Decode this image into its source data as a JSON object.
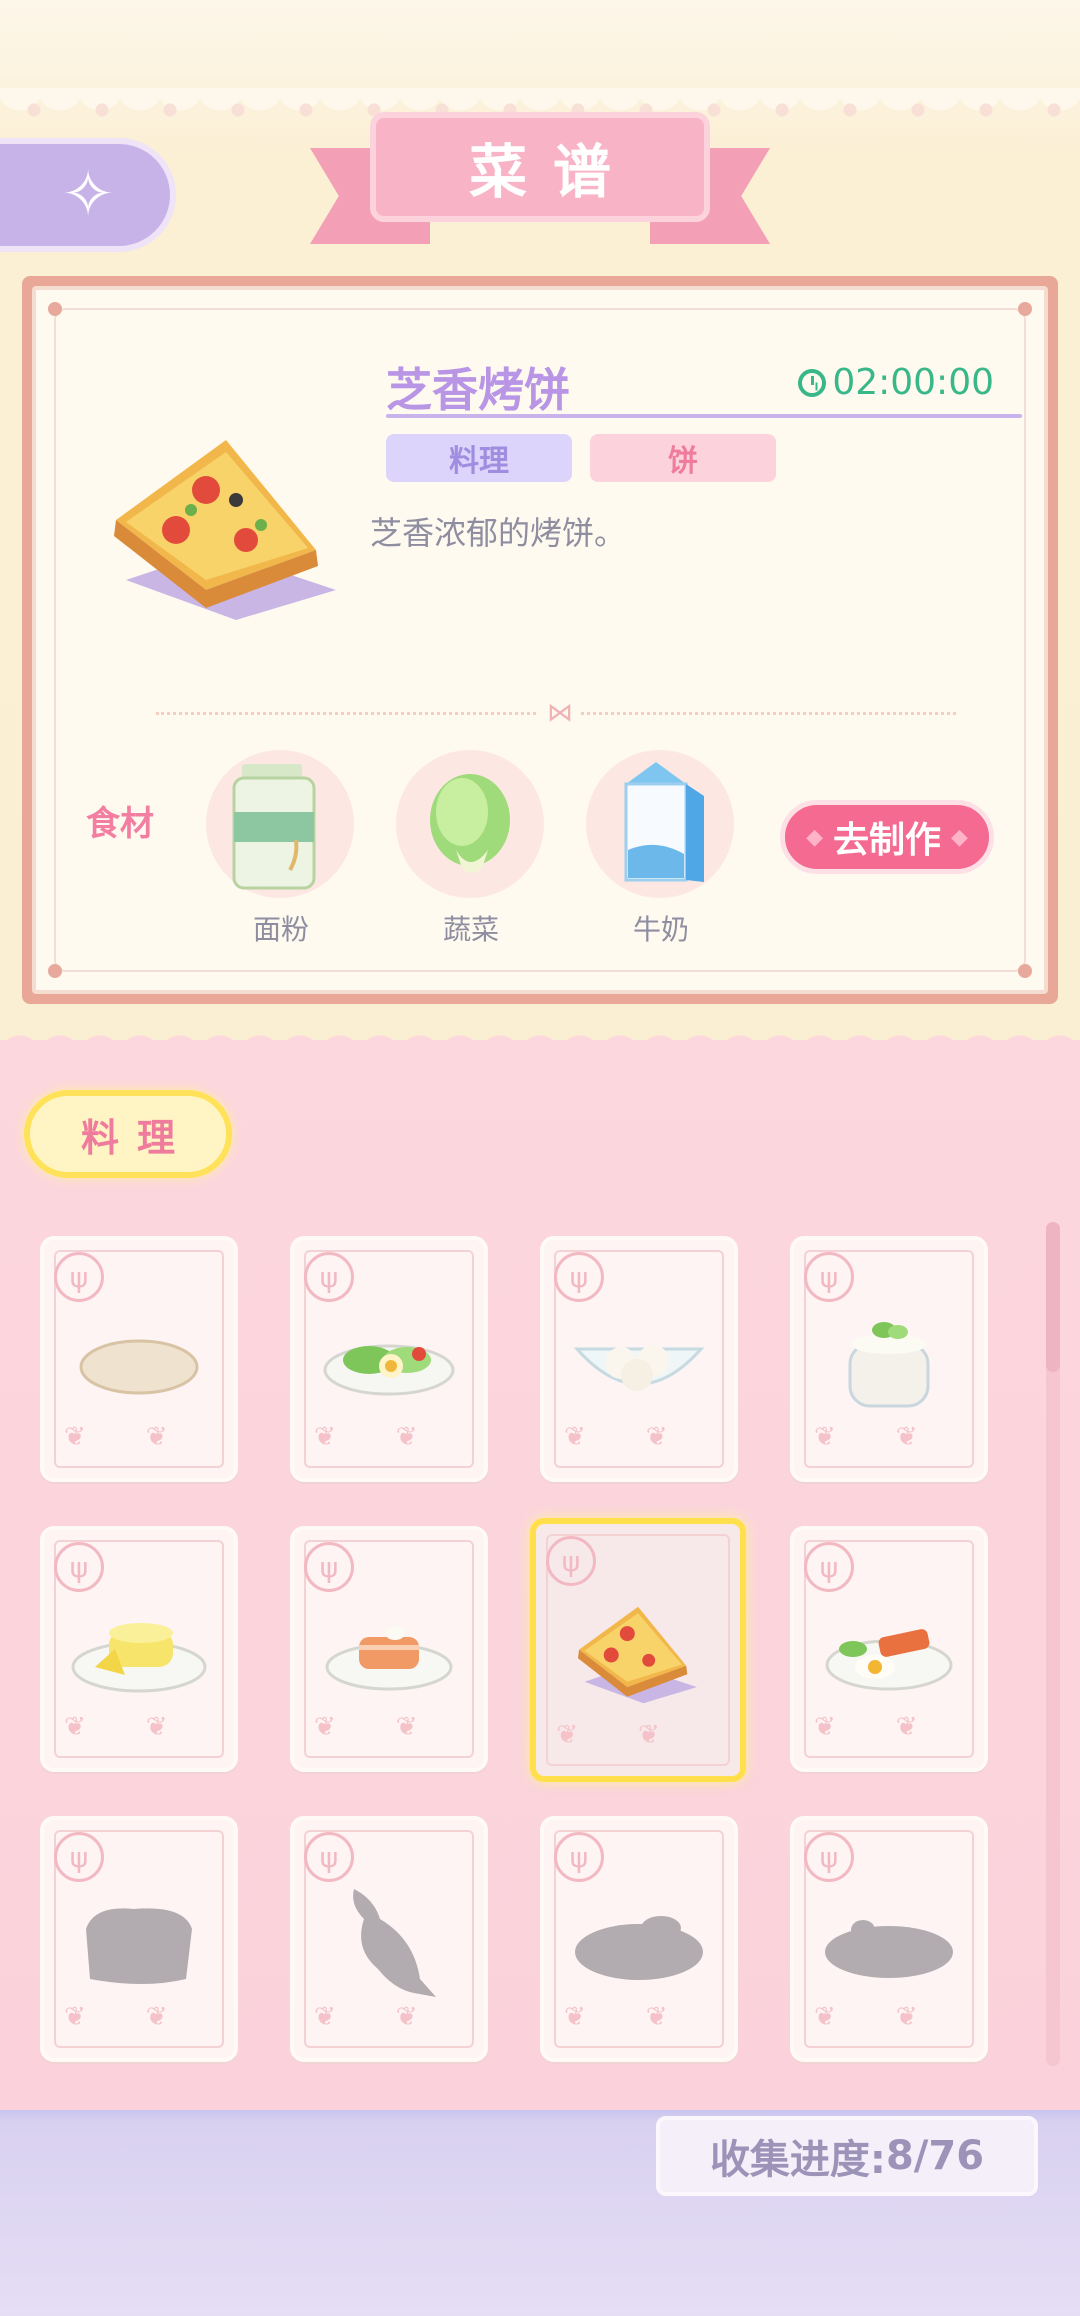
{
  "header": {
    "title": "菜谱",
    "back_icon": "back-arrow-icon"
  },
  "detail": {
    "name": "芝香烤饼",
    "timer": "02:00:00",
    "category_tag": "料理",
    "type_tag": "饼",
    "description": "芝香浓郁的烤饼。",
    "ingredients_label": "食材",
    "ingredients": [
      {
        "name": "面粉",
        "icon": "flour-bag-icon"
      },
      {
        "name": "蔬菜",
        "icon": "cabbage-icon"
      },
      {
        "name": "牛奶",
        "icon": "milk-carton-icon"
      }
    ],
    "make_button": "去制作"
  },
  "category_tab": "料理",
  "recipes": [
    {
      "item": "flatbread",
      "unlocked": true
    },
    {
      "item": "egg-salad",
      "unlocked": true
    },
    {
      "item": "rice-balls",
      "unlocked": true
    },
    {
      "item": "yogurt",
      "unlocked": true
    },
    {
      "item": "butter-cake",
      "unlocked": true
    },
    {
      "item": "salmon-dish",
      "unlocked": true
    },
    {
      "item": "pizza-slice",
      "unlocked": true,
      "selected": true
    },
    {
      "item": "breakfast-plate",
      "unlocked": true
    },
    {
      "item": "locked-1",
      "unlocked": false
    },
    {
      "item": "locked-fish",
      "unlocked": false
    },
    {
      "item": "locked-3",
      "unlocked": false
    },
    {
      "item": "locked-4",
      "unlocked": false
    }
  ],
  "collection": {
    "label": "收集进度:",
    "value": "8/76"
  },
  "colors": {
    "accent_pink": "#f46a90",
    "title_purple": "#b995e6",
    "timer_green": "#38b789"
  }
}
